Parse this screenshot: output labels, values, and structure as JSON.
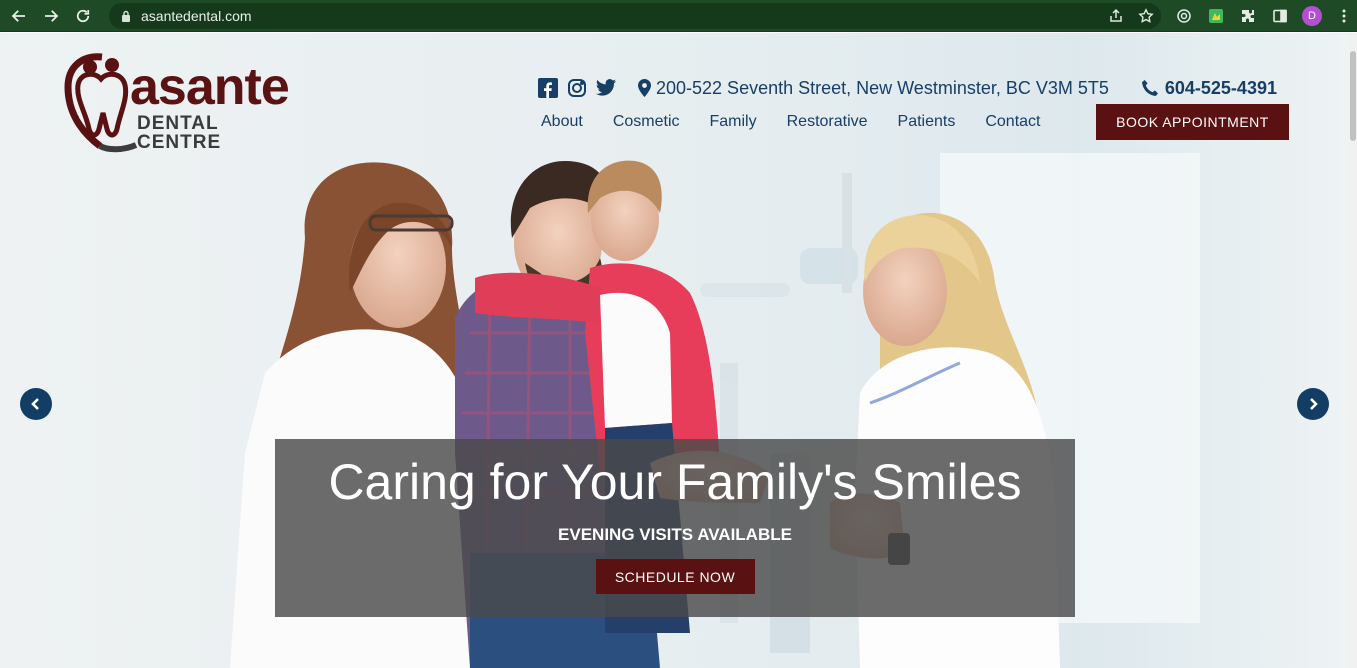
{
  "browser": {
    "url": "asantedental.com",
    "profile_initial": "D"
  },
  "header": {
    "logo_word": "asante",
    "logo_sub": "DENTAL CENTRE",
    "address": "200-522 Seventh Street, New Westminster, BC V3M 5T5",
    "phone": "604-525-4391",
    "book_label": "BOOK APPOINTMENT"
  },
  "nav": {
    "items": [
      "About",
      "Cosmetic",
      "Family",
      "Restorative",
      "Patients",
      "Contact"
    ]
  },
  "hero": {
    "title": "Caring for Your Family's Smiles",
    "subtitle": "EVENING VISITS AVAILABLE",
    "cta_label": "SCHEDULE NOW"
  },
  "colors": {
    "brand_maroon": "#5a1111",
    "brand_navy": "#173f66",
    "chrome_green": "#1f4a26"
  }
}
